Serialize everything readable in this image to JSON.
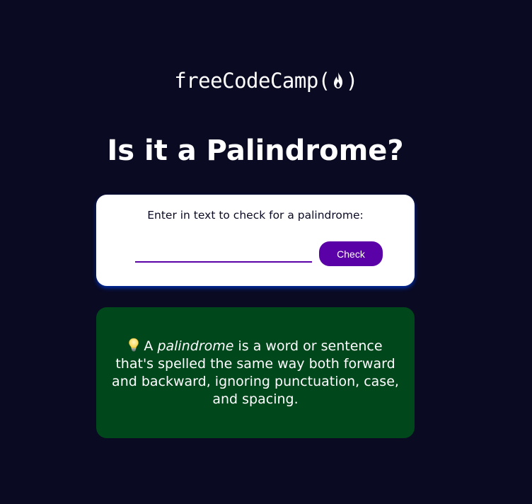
{
  "header": {
    "logo_text": "freeCodeCamp",
    "logo_paren_open": "(",
    "logo_paren_close": ")",
    "logo_icon": "flame-icon"
  },
  "main": {
    "title": "Is it a Palindrome?",
    "input_label": "Enter in text to check for a palindrome:",
    "input_value": "",
    "input_placeholder": "",
    "check_button_label": "Check"
  },
  "info": {
    "icon": "lightbulb-icon",
    "prefix": "A",
    "term": "palindrome",
    "definition": "is a word or sentence that's spelled the same way both forward and backward, ignoring punctuation, case, and spacing."
  },
  "colors": {
    "background": "#0a0a23",
    "button": "#5a01a7",
    "info_box": "#00471b",
    "card": "#ffffff"
  }
}
